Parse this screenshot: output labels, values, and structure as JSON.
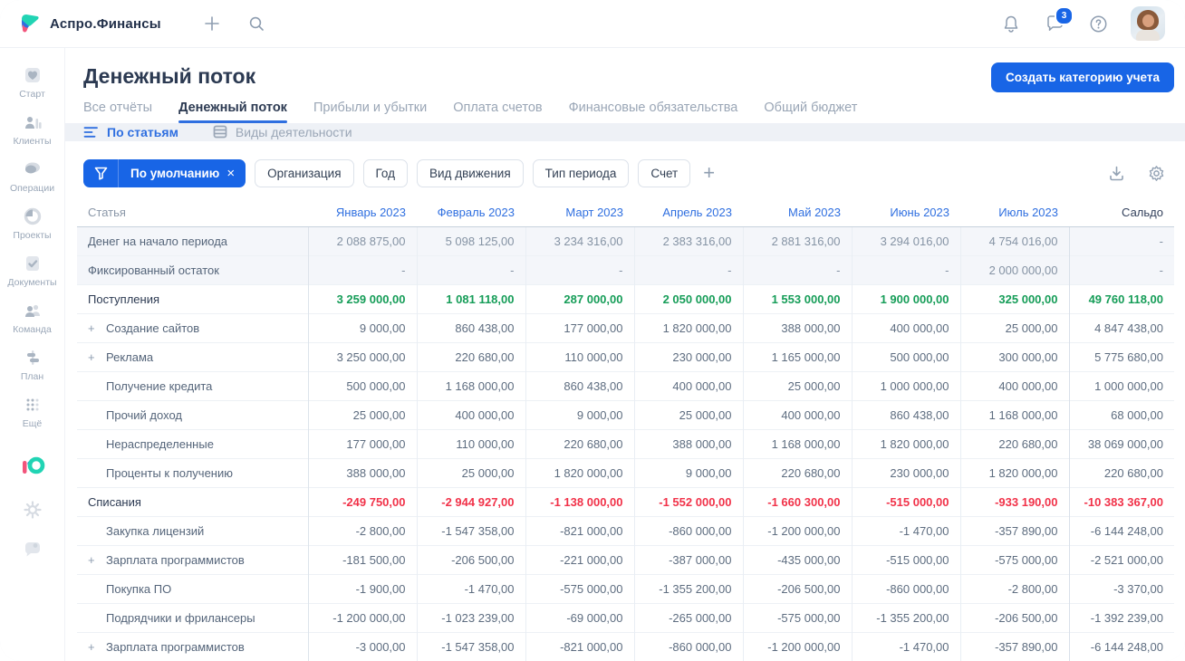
{
  "topbar": {
    "brand": "Аспро.Финансы",
    "chat_badge": "3"
  },
  "sidebar": {
    "items": [
      {
        "label": "Старт"
      },
      {
        "label": "Клиенты"
      },
      {
        "label": "Операции"
      },
      {
        "label": "Проекты"
      },
      {
        "label": "Документы"
      },
      {
        "label": "Команда"
      },
      {
        "label": "План"
      },
      {
        "label": "Ещё"
      }
    ]
  },
  "header": {
    "title": "Денежный поток",
    "create_button": "Создать категорию учета"
  },
  "tabs": [
    {
      "label": "Все отчёты",
      "active": false
    },
    {
      "label": "Денежный поток",
      "active": true
    },
    {
      "label": "Прибыли и убытки",
      "active": false
    },
    {
      "label": "Оплата счетов",
      "active": false
    },
    {
      "label": "Финансовые обязательства",
      "active": false
    },
    {
      "label": "Общий бюджет",
      "active": false
    }
  ],
  "subtabs": [
    {
      "label": "По статьям",
      "active": true
    },
    {
      "label": "Виды деятельности",
      "active": false
    }
  ],
  "filters": {
    "active_chip": "По умолчанию",
    "chips": [
      "Организация",
      "Год",
      "Вид движения",
      "Тип периода",
      "Счет"
    ]
  },
  "table": {
    "first_column": "Статья",
    "last_column": "Сальдо",
    "months": [
      "Январь 2023",
      "Февраль 2023",
      "Март 2023",
      "Апрель 2023",
      "Май 2023",
      "Июнь 2023",
      "Июль 2023"
    ],
    "rows": [
      {
        "label": "Денег на начало периода",
        "style": "muted",
        "expand": false,
        "indent": false,
        "values": [
          "2 088 875,00",
          "5 098 125,00",
          "3 234 316,00",
          "2 383 316,00",
          "2 881 316,00",
          "3 294 016,00",
          "4 754 016,00",
          "-"
        ]
      },
      {
        "label": "Фиксированный остаток",
        "style": "muted",
        "expand": false,
        "indent": false,
        "values": [
          "-",
          "-",
          "-",
          "-",
          "-",
          "-",
          "2 000 000,00",
          "-"
        ]
      },
      {
        "label": "Поступления",
        "style": "income",
        "expand": false,
        "indent": false,
        "values": [
          "3 259 000,00",
          "1 081 118,00",
          "287 000,00",
          "2 050 000,00",
          "1 553 000,00",
          "1 900 000,00",
          "325 000,00",
          "49 760 118,00"
        ]
      },
      {
        "label": "Создание сайтов",
        "style": "normal",
        "expand": true,
        "indent": true,
        "values": [
          "9 000,00",
          "860 438,00",
          "177 000,00",
          "1 820 000,00",
          "388 000,00",
          "400 000,00",
          "25 000,00",
          "4 847 438,00"
        ]
      },
      {
        "label": "Реклама",
        "style": "normal",
        "expand": true,
        "indent": true,
        "values": [
          "3 250 000,00",
          "220 680,00",
          "110 000,00",
          "230 000,00",
          "1 165 000,00",
          "500 000,00",
          "300 000,00",
          "5 775 680,00"
        ]
      },
      {
        "label": "Получение кредита",
        "style": "normal",
        "expand": false,
        "indent": true,
        "values": [
          "500 000,00",
          "1 168 000,00",
          "860 438,00",
          "400 000,00",
          "25 000,00",
          "1 000 000,00",
          "400 000,00",
          "1 000 000,00"
        ]
      },
      {
        "label": "Прочий доход",
        "style": "normal",
        "expand": false,
        "indent": true,
        "values": [
          "25 000,00",
          "400 000,00",
          "9 000,00",
          "25 000,00",
          "400 000,00",
          "860 438,00",
          "1 168 000,00",
          "68 000,00"
        ]
      },
      {
        "label": "Нераспределенные",
        "style": "normal",
        "expand": false,
        "indent": true,
        "values": [
          "177 000,00",
          "110 000,00",
          "220 680,00",
          "388 000,00",
          "1 168 000,00",
          "1 820 000,00",
          "220 680,00",
          "38 069 000,00"
        ]
      },
      {
        "label": "Проценты к получению",
        "style": "normal",
        "expand": false,
        "indent": true,
        "values": [
          "388 000,00",
          "25 000,00",
          "1 820 000,00",
          "9 000,00",
          "220 680,00",
          "230 000,00",
          "1 820 000,00",
          "220 680,00"
        ]
      },
      {
        "label": "Списания",
        "style": "expense",
        "expand": false,
        "indent": false,
        "values": [
          "-249 750,00",
          "-2 944 927,00",
          "-1 138 000,00",
          "-1 552 000,00",
          "-1 660 300,00",
          "-515 000,00",
          "-933 190,00",
          "-10 383 367,00"
        ]
      },
      {
        "label": "Закупка лицензий",
        "style": "normal",
        "expand": false,
        "indent": true,
        "values": [
          "-2 800,00",
          "-1 547 358,00",
          "-821 000,00",
          "-860 000,00",
          "-1 200 000,00",
          "-1 470,00",
          "-357 890,00",
          "-6 144 248,00"
        ]
      },
      {
        "label": "Зарплата программистов",
        "style": "normal",
        "expand": true,
        "indent": true,
        "values": [
          "-181 500,00",
          "-206 500,00",
          "-221 000,00",
          "-387 000,00",
          "-435 000,00",
          "-515 000,00",
          "-575 000,00",
          "-2 521 000,00"
        ]
      },
      {
        "label": "Покупка ПО",
        "style": "normal",
        "expand": false,
        "indent": true,
        "values": [
          "-1 900,00",
          "-1 470,00",
          "-575 000,00",
          "-1 355 200,00",
          "-206 500,00",
          "-860 000,00",
          "-2 800,00",
          "-3 370,00"
        ]
      },
      {
        "label": "Подрядчики и фрилансеры",
        "style": "normal",
        "expand": false,
        "indent": true,
        "values": [
          "-1 200 000,00",
          "-1 023 239,00",
          "-69 000,00",
          "-265 000,00",
          "-575 000,00",
          "-1 355 200,00",
          "-206 500,00",
          "-1 392 239,00"
        ]
      },
      {
        "label": "Зарплата программистов",
        "style": "normal",
        "expand": true,
        "indent": true,
        "values": [
          "-3 000,00",
          "-1 547 358,00",
          "-821 000,00",
          "-860 000,00",
          "-1 200 000,00",
          "-1 470,00",
          "-357 890,00",
          "-6 144 248,00"
        ]
      }
    ]
  },
  "colors": {
    "accent": "#1865e6",
    "income_green": "#169d58",
    "expense_red": "#f13249"
  }
}
